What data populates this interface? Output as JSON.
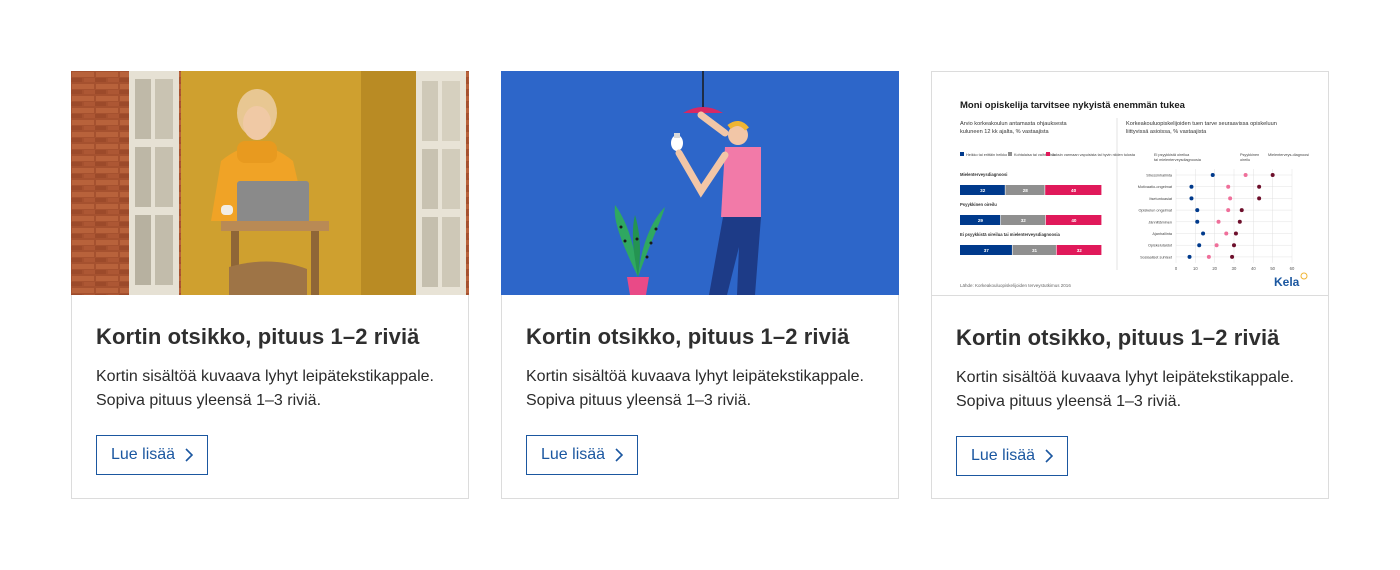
{
  "cards": [
    {
      "title": "Kortin otsikko, pituus 1–2 riviä",
      "description_line1": "Kortin sisältöä kuvaava lyhyt leipätekstikappale.",
      "description_line2": "Sopiva pituus yleensä 1–3 riviä.",
      "button_label": "Lue lisää",
      "image": "photo-woman-laptop"
    },
    {
      "title": "Kortin otsikko, pituus 1–2 riviä",
      "description_line1": "Kortin sisältöä kuvaava lyhyt leipätekstikappale.",
      "description_line2": "Sopiva pituus yleensä 1–3 riviä.",
      "button_label": "Lue lisää",
      "image": "illustration-man-lightbulb"
    },
    {
      "title": "Kortin otsikko, pituus 1–2 riviä",
      "description_line1": "Kortin sisältöä kuvaava lyhyt leipätekstikappale.",
      "description_line2": "Sopiva pituus yleensä 1–3 riviä.",
      "button_label": "Lue lisää",
      "image": "infographic"
    }
  ],
  "infographic": {
    "title": "Moni opiskelija tarvitsee nykyistä enemmän tukea",
    "left_subtitle_1": "Arvio korkeakoulun antamasta ohjauksesta",
    "left_subtitle_2": "kuluneen 12 kk ajalta, % vastaajista",
    "legend": [
      "Heikko tai erittäin heikko",
      "Kohtalaisa tai vaihtoehto",
      "Joksin varmaan vapuisista tai hyvin niiden tulosta"
    ],
    "groups": [
      {
        "label": "Mielenterveysdiagnoosi",
        "values": [
          32,
          28,
          40
        ]
      },
      {
        "label": "Psyykkinen oireilu",
        "values": [
          29,
          32,
          40
        ]
      },
      {
        "label": "Ei psyykkistä oireilua tai mielenterveysdiagnoosia",
        "values": [
          37,
          31,
          32
        ]
      }
    ],
    "right_subtitle_1": "Korkeakouluopiskelijoiden tuen tarve seuraavissa opiskeluun",
    "right_subtitle_2": "liittyvissä asioissa, % vastaajista",
    "dot_legend": [
      "Ei psyykkistä oireilua tai mielenterveysdiagnoosia",
      "Psyykkinen oireilu",
      "Mielenterveys-diagnoosi"
    ],
    "rows": [
      {
        "label": "Stressinhallinta",
        "values": [
          19,
          36,
          50
        ]
      },
      {
        "label": "Motivaatio-ongelmat",
        "values": [
          8,
          27,
          43
        ]
      },
      {
        "label": "Itsetuntoasiat",
        "values": [
          8,
          28,
          43
        ]
      },
      {
        "label": "Opiskelun ongelmat",
        "values": [
          11,
          27,
          34
        ]
      },
      {
        "label": "Jännittäminen",
        "values": [
          11,
          22,
          33
        ]
      },
      {
        "label": "Ajanhallinta",
        "values": [
          14,
          26,
          31
        ]
      },
      {
        "label": "Opiskelutaidot",
        "values": [
          12,
          21,
          30
        ]
      },
      {
        "label": "Sosiaaliset suhteet",
        "values": [
          7,
          17,
          29
        ]
      }
    ],
    "x_ticks": [
      "0",
      "10",
      "20",
      "30",
      "40",
      "50",
      "60"
    ],
    "source": "Lähde: Korkeakouluopiskelijoiden terveystutkimus 2016",
    "logo": "Kela",
    "colors": {
      "blue": "#003a8c",
      "gray": "#8f8f8f",
      "pink": "#e0195a",
      "light_pink": "#ef6f9a",
      "maroon": "#6d0f2b"
    }
  }
}
